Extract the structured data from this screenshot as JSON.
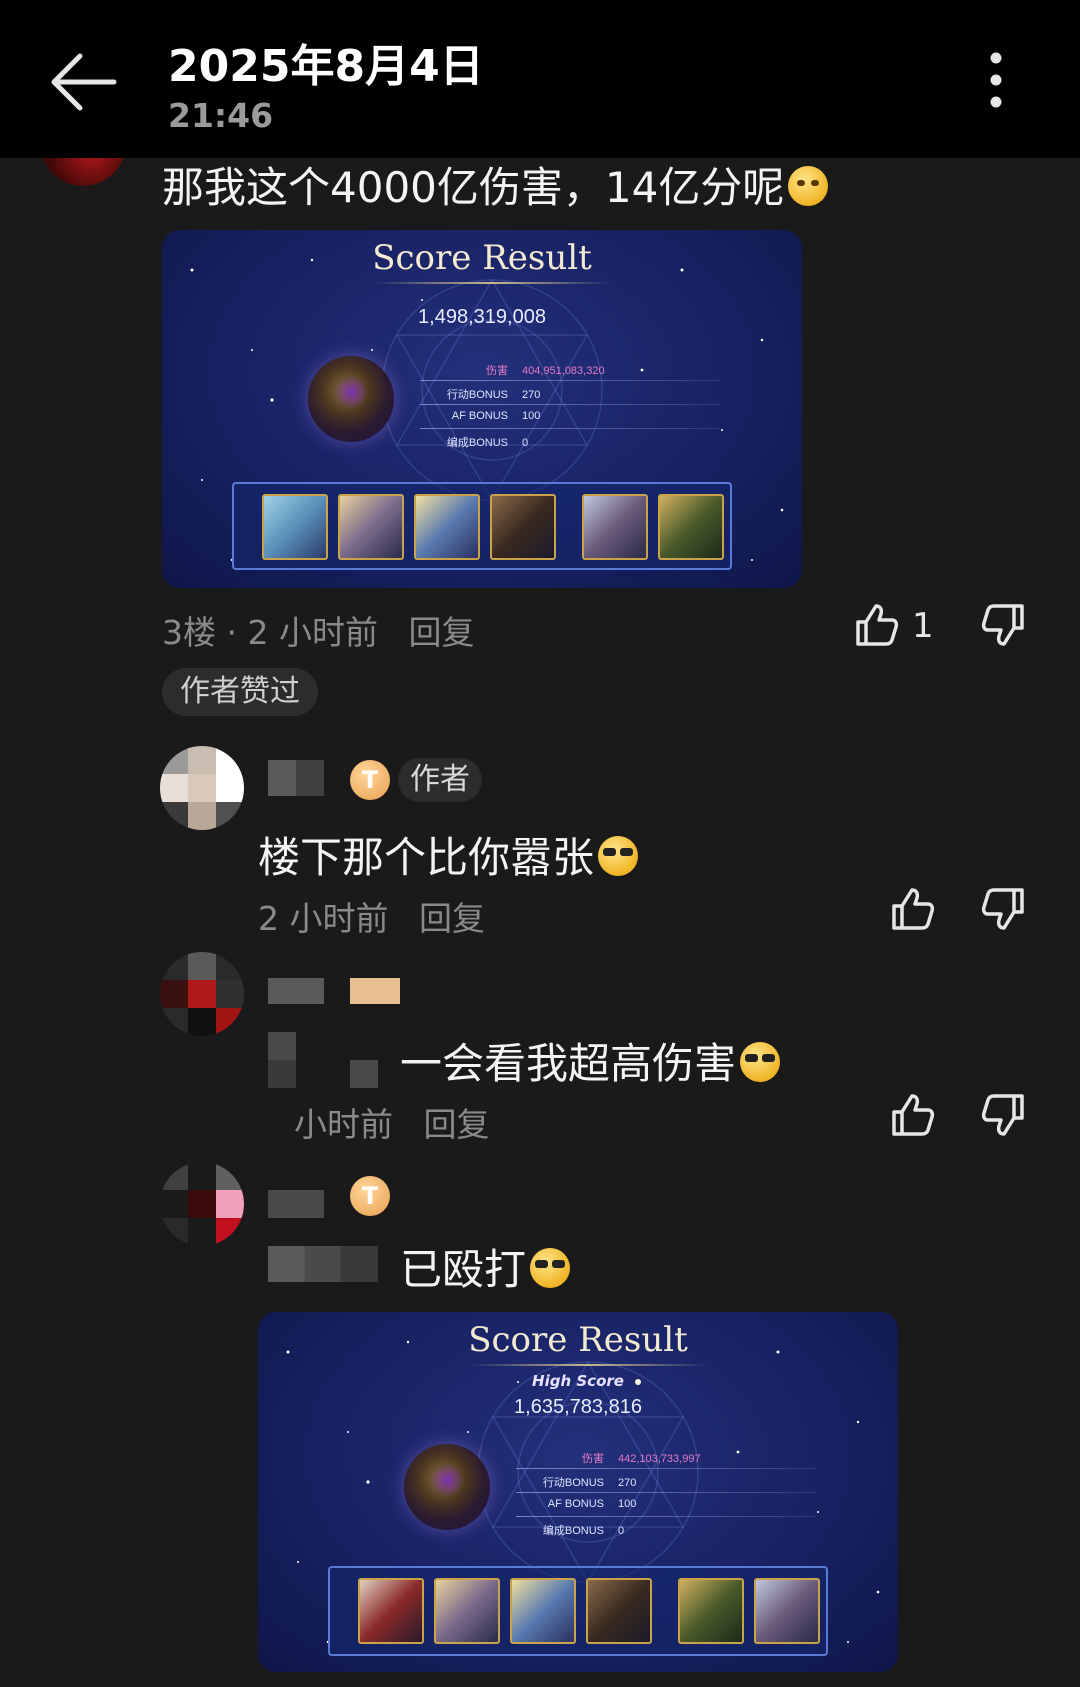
{
  "header": {
    "date": "2025年8月4日",
    "time": "21:46",
    "back_icon": "back-arrow-icon",
    "more_icon": "more-vertical-icon"
  },
  "comments": [
    {
      "text": "那我这个4000亿伤害，14亿分呢",
      "score_card": {
        "title": "Score Result",
        "total": "1,498,319,008",
        "rows": [
          {
            "label": "伤害",
            "value": "404,951,083,320"
          },
          {
            "label": "行动BONUS",
            "value": "270"
          },
          {
            "label": "AF BONUS",
            "value": "100"
          },
          {
            "label": "编成BONUS",
            "value": "0"
          }
        ]
      },
      "floor": "3楼",
      "time": "2 小时前",
      "reply": "回复",
      "likes": "1",
      "author_liked": "作者赞过"
    },
    {
      "badge": "T",
      "author_tag": "作者",
      "text": "楼下那个比你嚣张",
      "time": "2 小时前",
      "reply": "回复"
    },
    {
      "text": "一会看我超高伤害",
      "time": "小时前",
      "reply": "回复"
    },
    {
      "badge": "T",
      "text": "已殴打",
      "score_card": {
        "title": "Score Result",
        "high_score": "High Score",
        "total": "1,635,783,816",
        "rows": [
          {
            "label": "伤害",
            "value": "442,103,733,997"
          },
          {
            "label": "行动BONUS",
            "value": "270"
          },
          {
            "label": "AF BONUS",
            "value": "100"
          },
          {
            "label": "编成BONUS",
            "value": "0"
          }
        ]
      }
    }
  ],
  "colors": {
    "background": "#1a1a1a",
    "topbar": "#000000",
    "damage_pink": "#e57ac8",
    "card_blue": "#1a2468"
  }
}
